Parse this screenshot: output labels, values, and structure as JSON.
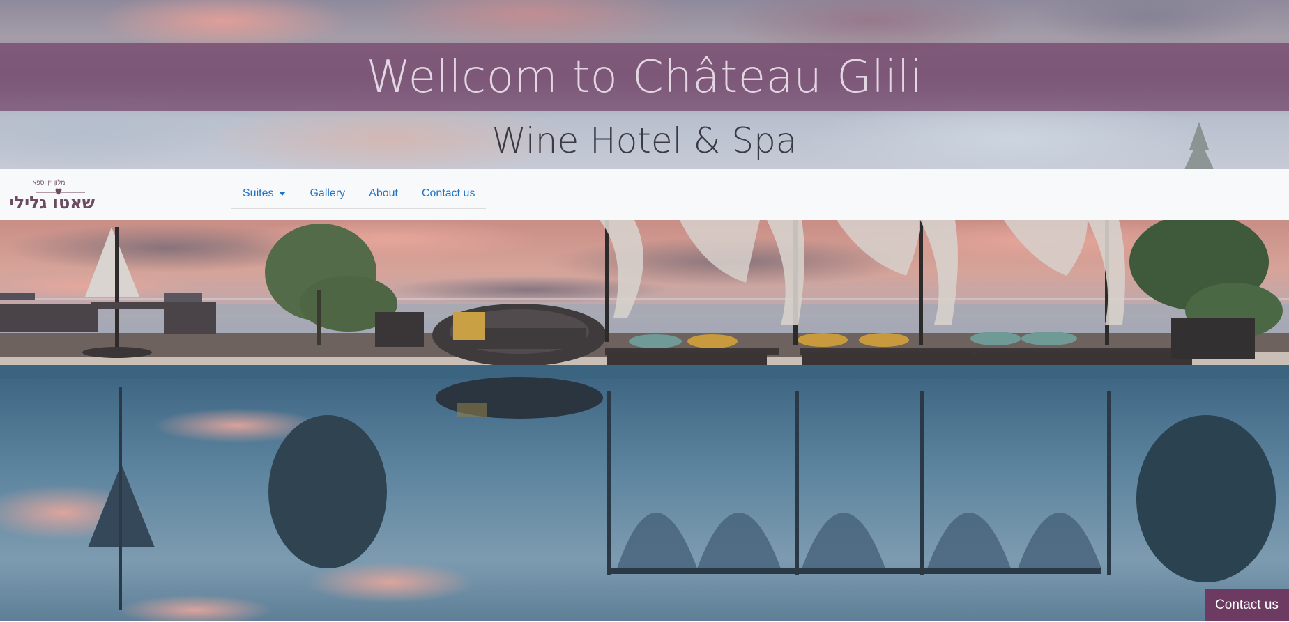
{
  "header": {
    "title": "Wellcom to Château Glili",
    "subtitle": "Wine Hotel & Spa"
  },
  "logo": {
    "tagline": "מלון יין וספא",
    "name": "שאטו גלילי"
  },
  "nav": {
    "items": [
      {
        "label": "Suites",
        "has_dropdown": true
      },
      {
        "label": "Gallery"
      },
      {
        "label": "About"
      },
      {
        "label": "Contact us"
      }
    ]
  },
  "floating_contact": {
    "label": "Contact us"
  },
  "colors": {
    "brand_purple": "#6d3a62",
    "title_band": "rgba(110,60,100,0.68)",
    "nav_link": "#1e73c8",
    "navbar_bg": "#f8f9fa"
  },
  "hero": {
    "icon": "pool-photo"
  }
}
